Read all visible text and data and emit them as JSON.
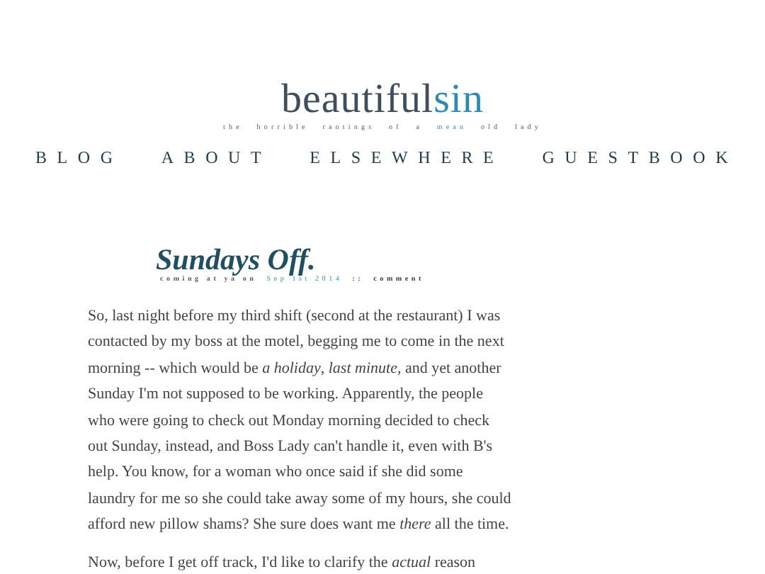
{
  "site": {
    "title": "beautiful",
    "title_accent": "sin",
    "tagline": "the horrible rantings of a **mean** old lady"
  },
  "nav": [
    {
      "label": "BLOG"
    },
    {
      "label": "ABOUT"
    },
    {
      "label": "ELSEWHERE"
    },
    {
      "label": "GUESTBOOK"
    }
  ],
  "post": {
    "title": "Sundays Off.",
    "meta_prefix": "coming at ya on",
    "date": "Sep 1st 2014",
    "separator": "::",
    "comment_link": "comment",
    "paragraphs": [
      "So, last night before my third shift (second at the restaurant) I was contacted by my boss at the motel, begging me to come in the next morning -- which would be *a holiday*, *last minute*, and yet another Sunday I'm not supposed to be working. Apparently, the people who were going to check out Monday morning decided to check out Sunday, instead, and Boss Lady can't handle it, even with B's help. You know, for a woman who once said if she did some laundry for me so she could take away some of my hours, she could afford new pillow shams? She sure does want me *there* all the time.",
      "Now, before I get off track, I'd like to clarify the *actual* reason"
    ]
  }
}
